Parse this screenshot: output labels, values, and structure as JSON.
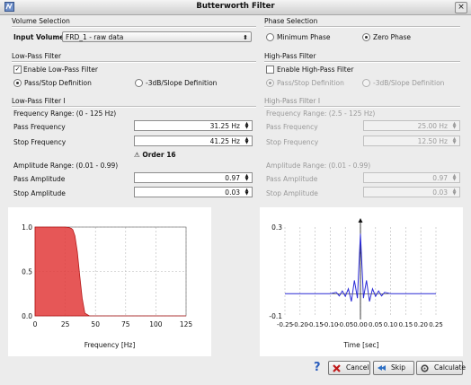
{
  "window": {
    "title": "Butterworth Filter",
    "icon": "filter-app-icon"
  },
  "volume_selection": {
    "title": "Volume Selection",
    "input_volume_label": "Input Volume",
    "input_volume_value": "FRD_1 -  raw data"
  },
  "phase_selection": {
    "title": "Phase Selection",
    "options": [
      "Minimum Phase",
      "Zero Phase"
    ],
    "selected": "Zero Phase"
  },
  "low_pass_filter": {
    "title": "Low-Pass Filter",
    "enable_label": "Enable Low-Pass Filter",
    "enabled": true,
    "definitions": [
      "Pass/Stop Definition",
      "-3dB/Slope Definition"
    ],
    "selected_definition": "Pass/Stop Definition"
  },
  "high_pass_filter": {
    "title": "High-Pass Filter",
    "enable_label": "Enable High-Pass Filter",
    "enabled": false,
    "definitions": [
      "Pass/Stop Definition",
      "-3dB/Slope Definition"
    ],
    "selected_definition": "Pass/Stop Definition"
  },
  "low_pass_params": {
    "title": "Low-Pass Filter I",
    "frequency_range": "Frequency Range: (0 - 125 Hz)",
    "pass_frequency_label": "Pass Frequency",
    "pass_frequency_value": "31.25 Hz",
    "stop_frequency_label": "Stop Frequency",
    "stop_frequency_value": "41.25 Hz",
    "order": "Order 16",
    "amplitude_range": "Amplitude Range: (0.01 - 0.99)",
    "pass_amplitude_label": "Pass Amplitude",
    "pass_amplitude_value": "0.97",
    "stop_amplitude_label": "Stop Amplitude",
    "stop_amplitude_value": "0.03"
  },
  "high_pass_params": {
    "title": "High-Pass Filter I",
    "frequency_range": "Frequency Range: (2.5 - 125 Hz)",
    "pass_frequency_label": "Pass Frequency",
    "pass_frequency_value": "25.00 Hz",
    "stop_frequency_label": "Stop Frequency",
    "stop_frequency_value": "12.50 Hz",
    "amplitude_range": "Amplitude Range: (0.01 - 0.99)",
    "pass_amplitude_label": "Pass Amplitude",
    "pass_amplitude_value": "0.97",
    "stop_amplitude_label": "Stop Amplitude",
    "stop_amplitude_value": "0.03"
  },
  "buttons": {
    "cancel": "Cancel",
    "skip": "Skip",
    "calculate": "Calculate"
  },
  "colors": {
    "frequency_fill": "#e23a3a",
    "impulse_line": "#2b2bd6",
    "help": "#2a5dbc"
  },
  "chart_data": [
    {
      "type": "area",
      "xlabel": "Frequency [Hz]",
      "x_ticks": [
        "0",
        "25",
        "50",
        "75",
        "100",
        "125"
      ],
      "y_ticks": [
        "0.0",
        "0.5",
        "1.0"
      ],
      "xlim": [
        0,
        125
      ],
      "ylim": [
        0,
        1.0
      ],
      "grid": true,
      "series": [
        {
          "x": [
            0,
            25,
            28,
            30,
            31.25,
            33,
            35,
            37,
            39,
            41.25,
            45,
            125
          ],
          "y": [
            1,
            1,
            0.995,
            0.985,
            0.97,
            0.9,
            0.72,
            0.45,
            0.2,
            0.03,
            0,
            0
          ]
        }
      ]
    },
    {
      "type": "line",
      "xlabel": "Time [sec]",
      "x_ticks": [
        "-0.25",
        "-0.20",
        "-0.15",
        "-0.10",
        "-0.05",
        "0.00",
        "0.05",
        "0.10",
        "0.15",
        "0.20",
        "0.25"
      ],
      "y_ticks": [
        "0.3",
        "-0.1"
      ],
      "xlim": [
        -0.25,
        0.25
      ],
      "ylim": [
        -0.1,
        0.3
      ],
      "grid": true,
      "series": [
        {
          "x": [
            -0.25,
            -0.1,
            -0.08,
            -0.07,
            -0.06,
            -0.05,
            -0.04,
            -0.03,
            -0.02,
            -0.01,
            0.0,
            0.01,
            0.02,
            0.03,
            0.04,
            0.05,
            0.06,
            0.07,
            0.08,
            0.1,
            0.25
          ],
          "y": [
            0,
            0,
            0.006,
            -0.01,
            0.012,
            -0.012,
            0.022,
            -0.035,
            0.06,
            -0.02,
            0.27,
            -0.02,
            0.06,
            -0.035,
            0.022,
            -0.012,
            0.012,
            -0.01,
            0.006,
            0,
            0
          ]
        }
      ]
    }
  ]
}
